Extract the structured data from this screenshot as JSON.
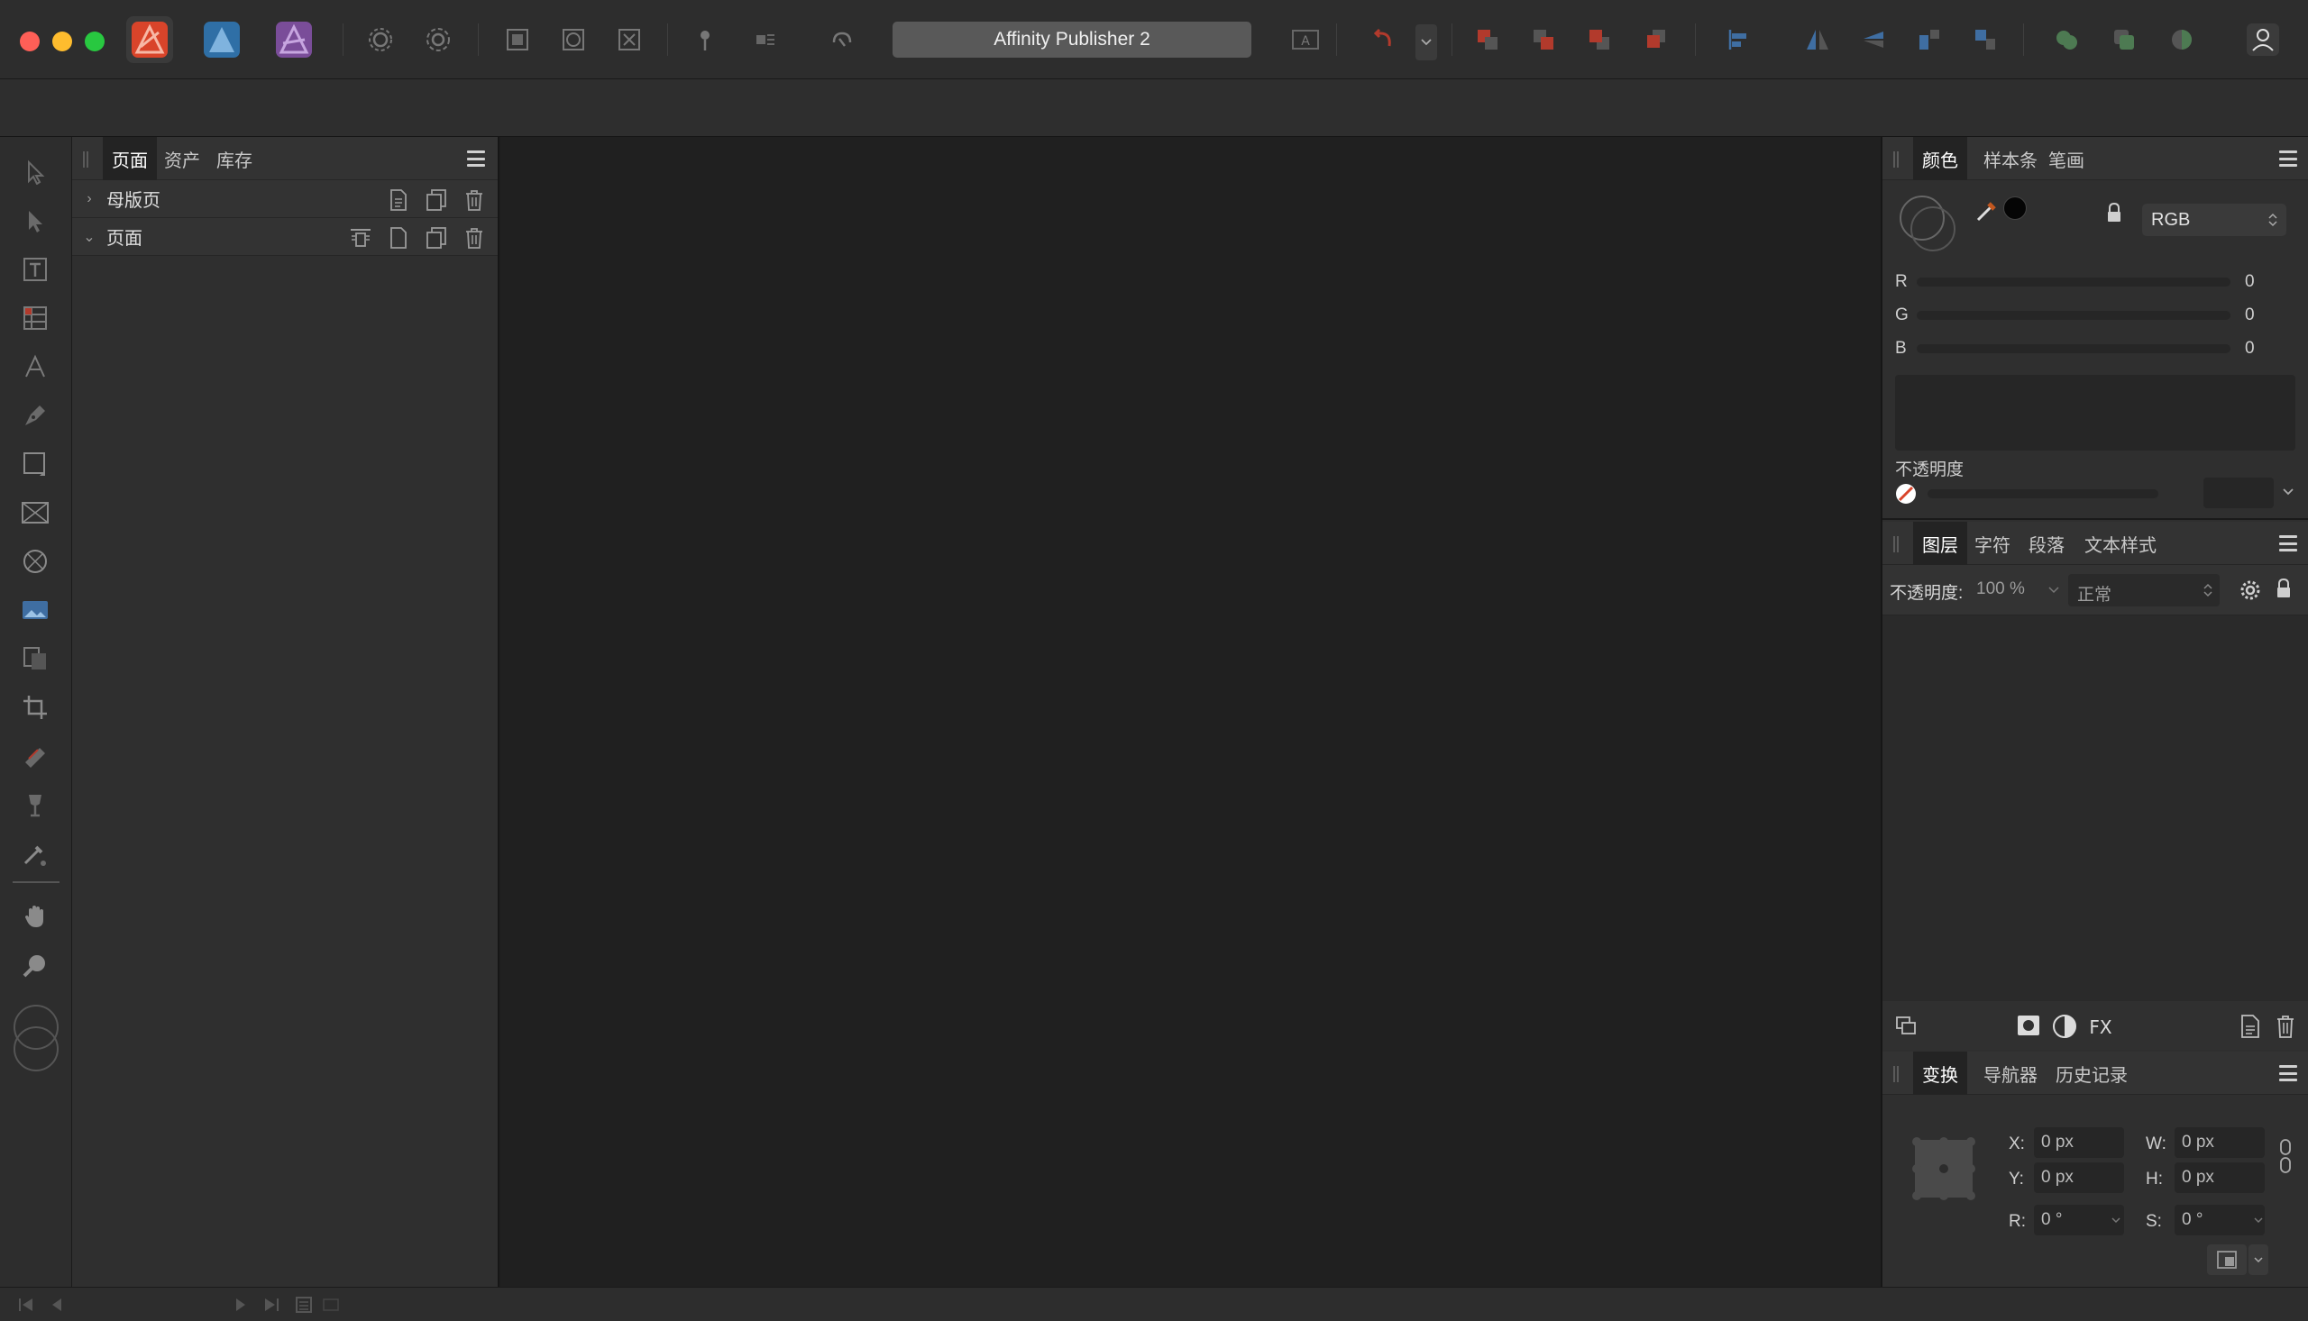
{
  "window": {
    "title": "Affinity Publisher 2",
    "traffic_lights": {
      "close": "#fe5f57",
      "minimize": "#febc2e",
      "maximize": "#28c840"
    }
  },
  "apps": [
    {
      "name": "publisher-app-icon",
      "color": "#d9442a"
    },
    {
      "name": "designer-app-icon",
      "color": "#2f6fa6"
    },
    {
      "name": "photo-app-icon",
      "color": "#7a4d99"
    }
  ],
  "left_panel": {
    "tabs": [
      "页面",
      "资产",
      "库存"
    ],
    "active_tab": "页面",
    "sections": [
      {
        "label": "母版页",
        "expanded": false
      },
      {
        "label": "页面",
        "expanded": true
      }
    ]
  },
  "color_panel": {
    "tabs": [
      "颜色",
      "样本条",
      "笔画"
    ],
    "active_tab": "颜色",
    "mode": "RGB",
    "channels": [
      {
        "label": "R",
        "value": "0"
      },
      {
        "label": "G",
        "value": "0"
      },
      {
        "label": "B",
        "value": "0"
      }
    ],
    "opacity_label": "不透明度"
  },
  "layers_panel": {
    "tabs": [
      "图层",
      "字符",
      "段落",
      "文本样式"
    ],
    "active_tab": "图层",
    "opacity_label": "不透明度:",
    "opacity_value": "100 %",
    "blend_mode": "正常"
  },
  "transform_panel": {
    "tabs": [
      "变换",
      "导航器",
      "历史记录"
    ],
    "active_tab": "变换",
    "fields": {
      "x_label": "X:",
      "x_value": "0 px",
      "y_label": "Y:",
      "y_value": "0 px",
      "w_label": "W:",
      "w_value": "0 px",
      "h_label": "H:",
      "h_value": "0 px",
      "r_label": "R:",
      "r_value": "0 °",
      "s_label": "S:",
      "s_value": "0 °"
    }
  },
  "colors": {
    "accent_active_tab": "#232323",
    "toolbar_bg": "#2d2d2d",
    "canvas_bg": "#202020"
  }
}
